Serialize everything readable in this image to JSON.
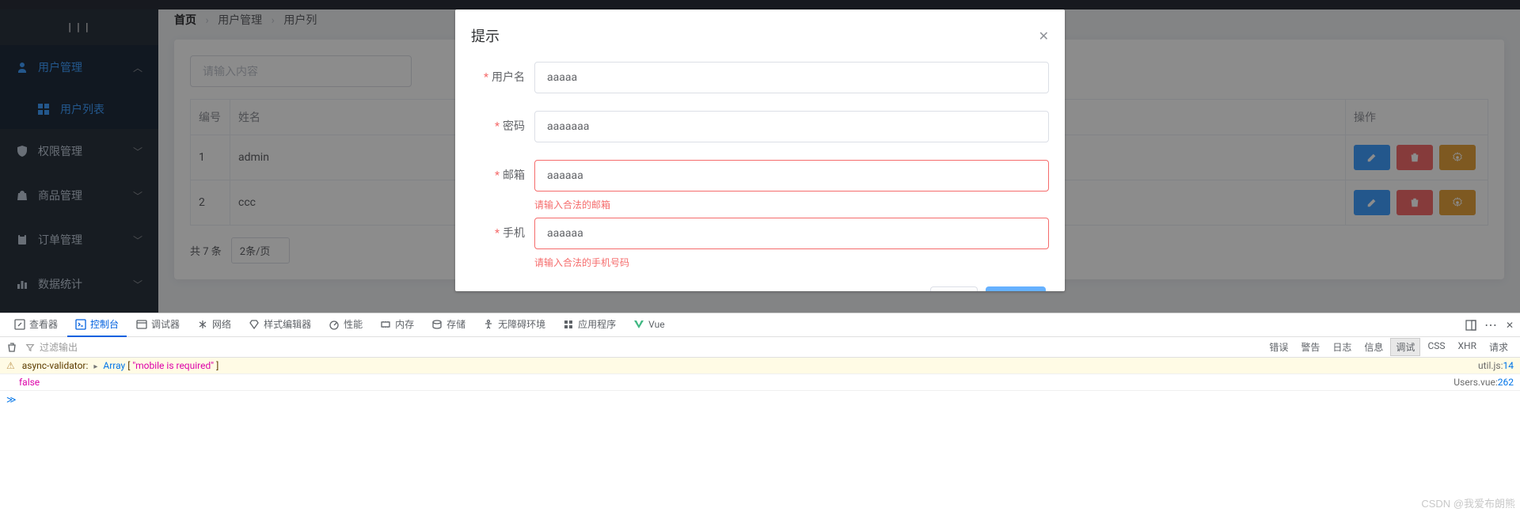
{
  "sidebar": {
    "logo": "| | |",
    "items": [
      {
        "label": "用户管理",
        "icon": "users-icon",
        "expanded": true,
        "active": true
      },
      {
        "label": "权限管理",
        "icon": "shield-icon",
        "expanded": false
      },
      {
        "label": "商品管理",
        "icon": "bag-icon",
        "expanded": false
      },
      {
        "label": "订单管理",
        "icon": "clipboard-icon",
        "expanded": false
      },
      {
        "label": "数据统计",
        "icon": "chart-icon",
        "expanded": false
      }
    ],
    "subitem": {
      "label": "用户列表",
      "icon": "grid-icon"
    }
  },
  "breadcrumb": {
    "home": "首页",
    "l1": "用户管理",
    "l2": "用户列"
  },
  "search": {
    "placeholder": "请输入内容"
  },
  "table": {
    "headers": {
      "id": "编号",
      "name": "姓名",
      "ops": "操作"
    },
    "rows": [
      {
        "id": "1",
        "name": "admin"
      },
      {
        "id": "2",
        "name": "ccc"
      }
    ]
  },
  "pagination": {
    "total": "共 7 条",
    "perpage": "2条/页"
  },
  "modal": {
    "title": "提示",
    "fields": {
      "username": {
        "label": "用户名",
        "value": "aaaaa"
      },
      "password": {
        "label": "密码",
        "value": "aaaaaaa"
      },
      "email": {
        "label": "邮箱",
        "value": "aaaaaa",
        "error": "请输入合法的邮箱"
      },
      "mobile": {
        "label": "手机",
        "value": "aaaaaa",
        "error": "请输入合法的手机号码"
      }
    }
  },
  "devtools": {
    "tabs": {
      "inspector": "查看器",
      "console": "控制台",
      "debugger": "调试器",
      "network": "网络",
      "style": "样式编辑器",
      "perf": "性能",
      "memory": "内存",
      "storage": "存储",
      "a11y": "无障碍环境",
      "apps": "应用程序",
      "vue": "Vue"
    },
    "filter_placeholder": "过滤输出",
    "levels": {
      "error": "错误",
      "warn": "警告",
      "log": "日志",
      "info": "信息",
      "debug": "调试",
      "css": "CSS",
      "xhr": "XHR",
      "req": "请求"
    },
    "lines": {
      "warn": {
        "prefix": "async-validator:",
        "arr": "Array",
        "msg": "\"mobile is required\"",
        "src": "util.js",
        "ln": "14"
      },
      "log": {
        "msg": "false",
        "src": "Users.vue",
        "ln": "262"
      }
    }
  },
  "watermark": "CSDN @我爱布朗熊"
}
